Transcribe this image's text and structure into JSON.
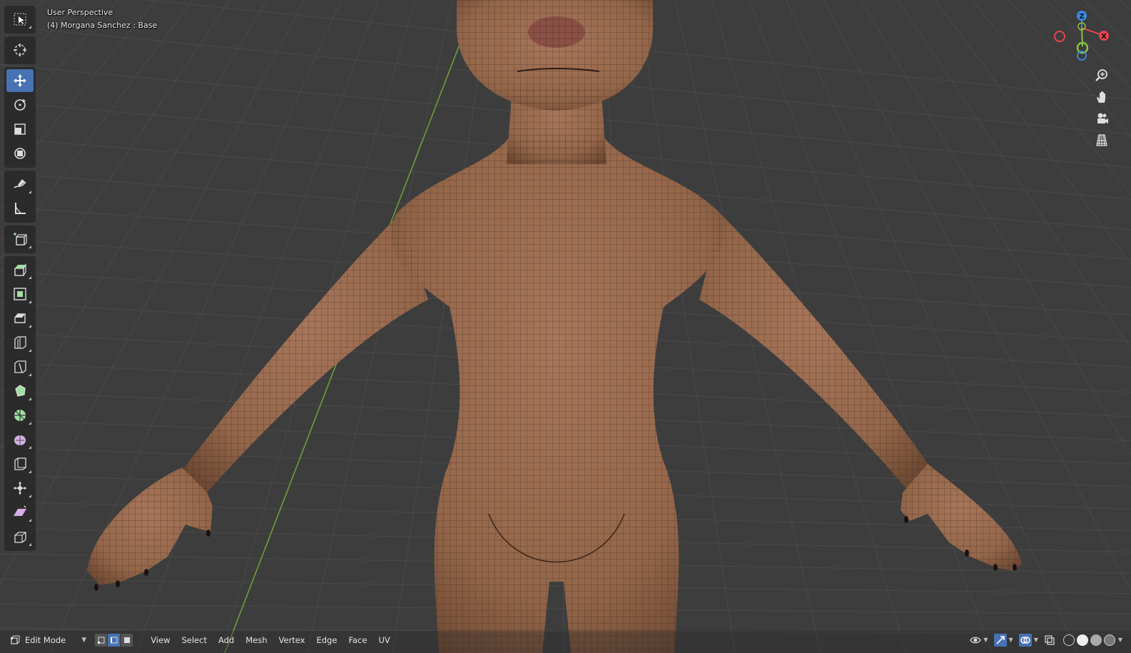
{
  "viewport": {
    "perspective": "User Perspective",
    "object": "(4) Morgana Sanchez : Base"
  },
  "toolbar": {
    "tools": [
      {
        "name": "select-box",
        "icon": "select-box-icon"
      },
      {
        "name": "cursor",
        "icon": "cursor-icon"
      },
      {
        "name": "move",
        "icon": "move-icon",
        "active": true
      },
      {
        "name": "rotate",
        "icon": "rotate-icon"
      },
      {
        "name": "scale",
        "icon": "scale-icon"
      },
      {
        "name": "transform",
        "icon": "transform-icon"
      },
      {
        "name": "annotate",
        "icon": "annotate-icon"
      },
      {
        "name": "measure",
        "icon": "measure-icon"
      },
      {
        "name": "add-cube",
        "icon": "add-cube-icon"
      },
      {
        "name": "extrude",
        "icon": "extrude-icon"
      },
      {
        "name": "inset",
        "icon": "inset-icon"
      },
      {
        "name": "bevel",
        "icon": "bevel-icon"
      },
      {
        "name": "loop-cut",
        "icon": "loop-cut-icon"
      },
      {
        "name": "knife",
        "icon": "knife-icon"
      },
      {
        "name": "poly-build",
        "icon": "poly-build-icon"
      },
      {
        "name": "spin",
        "icon": "spin-icon"
      },
      {
        "name": "smooth",
        "icon": "smooth-icon"
      },
      {
        "name": "edge-slide",
        "icon": "edge-slide-icon"
      },
      {
        "name": "shrink-fatten",
        "icon": "shrink-fatten-icon"
      },
      {
        "name": "shear",
        "icon": "shear-icon"
      },
      {
        "name": "rip-region",
        "icon": "rip-region-icon"
      }
    ]
  },
  "gizmo": {
    "z_label": "Z",
    "x_label": "X",
    "colors": {
      "x": "#e8434e",
      "y": "#8ac43e",
      "z": "#3d8be6"
    }
  },
  "nav": [
    "zoom-icon",
    "pan-hand-icon",
    "camera-icon",
    "grid-view-icon"
  ],
  "header": {
    "mode": "Edit Mode",
    "menu": [
      "View",
      "Select",
      "Add",
      "Mesh",
      "Vertex",
      "Edge",
      "Face",
      "UV"
    ]
  },
  "colors": {
    "background": "#3d3d3d",
    "grid": "#4a4a4a",
    "skin": "#9a6b4c",
    "active": "#4772b3",
    "y_axis_line": "#6c9e3a"
  }
}
